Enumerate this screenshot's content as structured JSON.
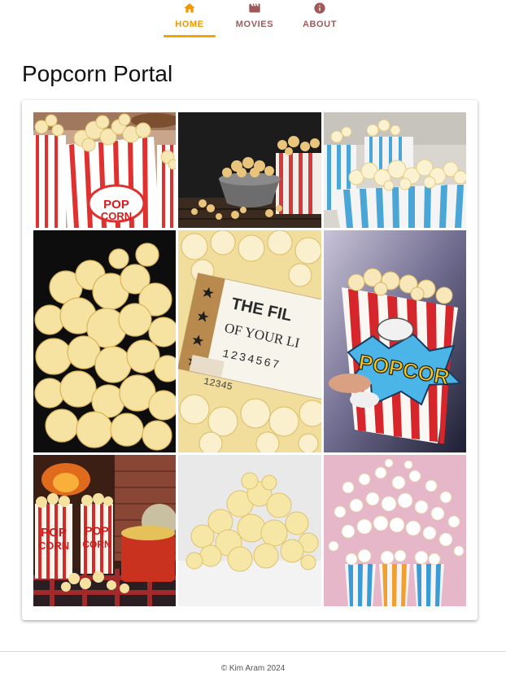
{
  "nav": {
    "tabs": [
      {
        "label": "HOME",
        "icon": "home-icon",
        "active": true
      },
      {
        "label": "MOVIES",
        "icon": "movie-icon",
        "active": false
      },
      {
        "label": "ABOUT",
        "icon": "info-icon",
        "active": false
      }
    ],
    "accent": "#f29700",
    "inactive_color": "#9e5a5a"
  },
  "page": {
    "title": "Popcorn Portal"
  },
  "gallery": {
    "images": [
      {
        "name": "popcorn-boxes-pop-corn",
        "text": "POP CORN"
      },
      {
        "name": "popcorn-bowl-dark",
        "text": ""
      },
      {
        "name": "popcorn-blue-striped-boxes",
        "text": ""
      },
      {
        "name": "popcorn-closeup",
        "text": ""
      },
      {
        "name": "movie-ticket-popcorn",
        "line1": "THE FIL",
        "line2": "OF YOUR LI",
        "line3": "1234567",
        "line4": "12345"
      },
      {
        "name": "popcorn-cup-comic",
        "text": "POPCOR"
      },
      {
        "name": "popcorn-bags-fireplace",
        "text": "POP CORN"
      },
      {
        "name": "popcorn-pile-white",
        "text": ""
      },
      {
        "name": "popcorn-cups-pink",
        "text": ""
      }
    ]
  },
  "footer": {
    "text": "© Kim Aram 2024"
  }
}
